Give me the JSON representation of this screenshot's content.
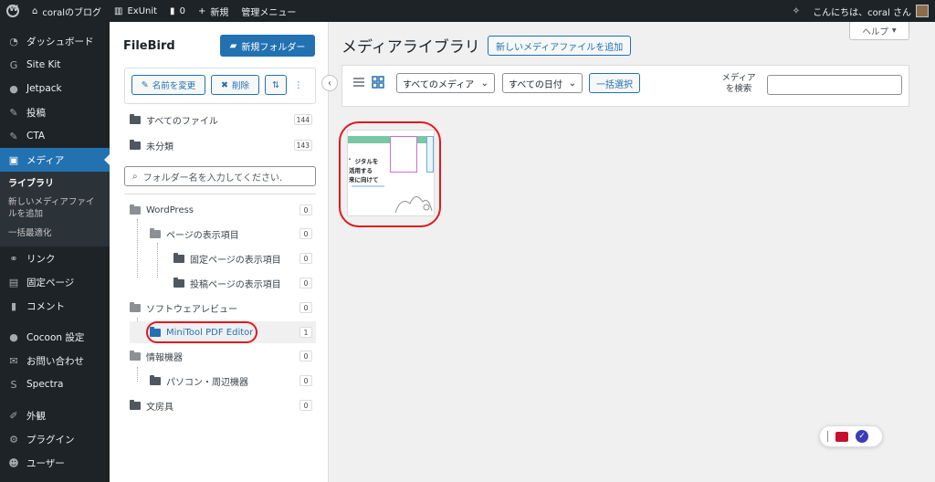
{
  "adminbar": {
    "site_name": "coralのブログ",
    "exunit": "ExUnit",
    "comments_count": "0",
    "new_label": "新規",
    "admin_menu": "管理メニュー",
    "greeting": "こんにちは、coral さん"
  },
  "sidebar": {
    "items": [
      {
        "label": "ダッシュボード",
        "icon": "dashboard-icon"
      },
      {
        "label": "Site Kit",
        "icon": "sitekit-icon"
      },
      {
        "label": "Jetpack",
        "icon": "jetpack-icon"
      },
      {
        "label": "投稿",
        "icon": "pin-icon"
      },
      {
        "label": "CTA",
        "icon": "pin-icon"
      },
      {
        "label": "メディア",
        "icon": "media-icon"
      }
    ],
    "submenu": [
      "ライブラリ",
      "新しいメディアファイルを追加",
      "一括最適化"
    ],
    "items2": [
      {
        "label": "リンク",
        "icon": "link-icon"
      },
      {
        "label": "固定ページ",
        "icon": "page-icon"
      },
      {
        "label": "コメント",
        "icon": "comment-icon"
      }
    ],
    "items3": [
      {
        "label": "Cocoon 設定",
        "icon": "cocoon-icon"
      },
      {
        "label": "お問い合わせ",
        "icon": "mail-icon"
      },
      {
        "label": "Spectra",
        "icon": "spectra-icon"
      }
    ],
    "items4": [
      {
        "label": "外観",
        "icon": "brush-icon"
      },
      {
        "label": "プラグイン",
        "icon": "plugin-icon"
      },
      {
        "label": "ユーザー",
        "icon": "user-icon"
      }
    ]
  },
  "filebird": {
    "title": "FileBird",
    "new_folder": "新規フォルダー",
    "rename": "名前を変更",
    "delete": "削除",
    "all_files": "すべてのファイル",
    "all_files_count": "144",
    "uncategorized": "未分類",
    "uncategorized_count": "143",
    "search_placeholder": "フォルダー名を入力してください.",
    "folders": [
      {
        "label": "WordPress",
        "count": "0"
      },
      {
        "label": "ページの表示項目",
        "count": "0"
      },
      {
        "label": "固定ページの表示項目",
        "count": "0"
      },
      {
        "label": "投稿ページの表示項目",
        "count": "0"
      },
      {
        "label": "ソフトウェアレビュー",
        "count": "0"
      },
      {
        "label": "MiniTool PDF Editor",
        "count": "1"
      },
      {
        "label": "情報機器",
        "count": "0"
      },
      {
        "label": "パソコン・周辺機器",
        "count": "0"
      },
      {
        "label": "文房具",
        "count": "0"
      }
    ]
  },
  "main": {
    "help": "ヘルプ",
    "title": "メディアライブラリ",
    "add_new": "新しいメディアファイルを追加",
    "filter_type": "すべてのメディア",
    "filter_date": "すべての日付",
    "bulk_select": "一括選択",
    "search_label": "メディアを検索",
    "thumb_text": [
      "゛ジタルを",
      "活用する",
      "来に向けて"
    ]
  },
  "colors": {
    "accent": "#2271b1",
    "adminbar": "#1d2327",
    "highlight_ring": "#e0191c"
  }
}
